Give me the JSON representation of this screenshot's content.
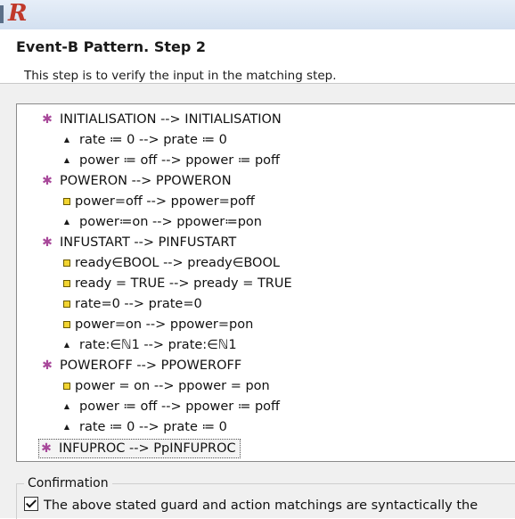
{
  "window": {
    "logo_icon": "r-logo-icon",
    "logo_text": "R",
    "accent_color": "#c0392b"
  },
  "header": {
    "title": "Event-B Pattern. Step 2",
    "description": "This step is to verify the input in the matching step."
  },
  "tree": {
    "items": [
      {
        "level": 0,
        "icon": "event-icon",
        "text": "INITIALISATION --> INITIALISATION"
      },
      {
        "level": 1,
        "icon": "action-icon",
        "text": "rate ≔ 0 --> prate ≔ 0"
      },
      {
        "level": 1,
        "icon": "action-icon",
        "text": "power ≔ off --> ppower ≔ poff"
      },
      {
        "level": 0,
        "icon": "event-icon",
        "text": "POWERON --> PPOWERON"
      },
      {
        "level": 1,
        "icon": "guard-icon",
        "text": "power=off --> ppower=poff"
      },
      {
        "level": 1,
        "icon": "action-icon",
        "text": "power≔on --> ppower≔pon"
      },
      {
        "level": 0,
        "icon": "event-icon",
        "text": "INFUSTART --> PINFUSTART"
      },
      {
        "level": 1,
        "icon": "guard-icon",
        "text": "ready∈BOOL --> pready∈BOOL"
      },
      {
        "level": 1,
        "icon": "guard-icon",
        "text": "ready = TRUE --> pready = TRUE"
      },
      {
        "level": 1,
        "icon": "guard-icon",
        "text": "rate=0 --> prate=0"
      },
      {
        "level": 1,
        "icon": "guard-icon",
        "text": "power=on --> ppower=pon"
      },
      {
        "level": 1,
        "icon": "action-icon",
        "text": "rate:∈ℕ1 --> prate:∈ℕ1"
      },
      {
        "level": 0,
        "icon": "event-icon",
        "text": "POWEROFF  --> PPOWEROFF"
      },
      {
        "level": 1,
        "icon": "guard-icon",
        "text": "power = on --> ppower = pon"
      },
      {
        "level": 1,
        "icon": "action-icon",
        "text": "power ≔ off --> ppower ≔ poff"
      },
      {
        "level": 1,
        "icon": "action-icon",
        "text": "rate ≔ 0 --> prate ≔ 0"
      },
      {
        "level": 0,
        "icon": "event-icon",
        "text": "INFUPROC --> PpINFUPROC",
        "selected": true
      }
    ]
  },
  "confirmation": {
    "legend": "Confirmation",
    "checkbox_label": "The above stated guard and action matchings are syntactically the",
    "checked": true
  }
}
